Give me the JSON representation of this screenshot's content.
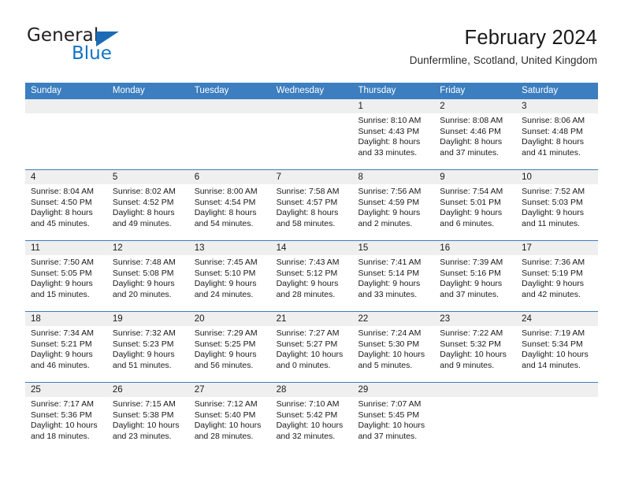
{
  "brand": {
    "name_part1": "General",
    "name_part2": "Blue",
    "logo_icon": "triangle-logo-icon",
    "accent_color": "#1b6cb5"
  },
  "header": {
    "title": "February 2024",
    "subtitle": "Dunfermline, Scotland, United Kingdom"
  },
  "colors": {
    "header_blue": "#3c7ebf",
    "day_band_gray": "#efefef",
    "text": "#1a1a1a"
  },
  "weekdays": [
    "Sunday",
    "Monday",
    "Tuesday",
    "Wednesday",
    "Thursday",
    "Friday",
    "Saturday"
  ],
  "weeks": [
    [
      {
        "day": "",
        "sunrise": "",
        "sunset": "",
        "daylight": "",
        "empty": true
      },
      {
        "day": "",
        "sunrise": "",
        "sunset": "",
        "daylight": "",
        "empty": true
      },
      {
        "day": "",
        "sunrise": "",
        "sunset": "",
        "daylight": "",
        "empty": true
      },
      {
        "day": "",
        "sunrise": "",
        "sunset": "",
        "daylight": "",
        "empty": true
      },
      {
        "day": "1",
        "sunrise": "Sunrise: 8:10 AM",
        "sunset": "Sunset: 4:43 PM",
        "daylight": "Daylight: 8 hours and 33 minutes.",
        "empty": false
      },
      {
        "day": "2",
        "sunrise": "Sunrise: 8:08 AM",
        "sunset": "Sunset: 4:46 PM",
        "daylight": "Daylight: 8 hours and 37 minutes.",
        "empty": false
      },
      {
        "day": "3",
        "sunrise": "Sunrise: 8:06 AM",
        "sunset": "Sunset: 4:48 PM",
        "daylight": "Daylight: 8 hours and 41 minutes.",
        "empty": false
      }
    ],
    [
      {
        "day": "4",
        "sunrise": "Sunrise: 8:04 AM",
        "sunset": "Sunset: 4:50 PM",
        "daylight": "Daylight: 8 hours and 45 minutes.",
        "empty": false
      },
      {
        "day": "5",
        "sunrise": "Sunrise: 8:02 AM",
        "sunset": "Sunset: 4:52 PM",
        "daylight": "Daylight: 8 hours and 49 minutes.",
        "empty": false
      },
      {
        "day": "6",
        "sunrise": "Sunrise: 8:00 AM",
        "sunset": "Sunset: 4:54 PM",
        "daylight": "Daylight: 8 hours and 54 minutes.",
        "empty": false
      },
      {
        "day": "7",
        "sunrise": "Sunrise: 7:58 AM",
        "sunset": "Sunset: 4:57 PM",
        "daylight": "Daylight: 8 hours and 58 minutes.",
        "empty": false
      },
      {
        "day": "8",
        "sunrise": "Sunrise: 7:56 AM",
        "sunset": "Sunset: 4:59 PM",
        "daylight": "Daylight: 9 hours and 2 minutes.",
        "empty": false
      },
      {
        "day": "9",
        "sunrise": "Sunrise: 7:54 AM",
        "sunset": "Sunset: 5:01 PM",
        "daylight": "Daylight: 9 hours and 6 minutes.",
        "empty": false
      },
      {
        "day": "10",
        "sunrise": "Sunrise: 7:52 AM",
        "sunset": "Sunset: 5:03 PM",
        "daylight": "Daylight: 9 hours and 11 minutes.",
        "empty": false
      }
    ],
    [
      {
        "day": "11",
        "sunrise": "Sunrise: 7:50 AM",
        "sunset": "Sunset: 5:05 PM",
        "daylight": "Daylight: 9 hours and 15 minutes.",
        "empty": false
      },
      {
        "day": "12",
        "sunrise": "Sunrise: 7:48 AM",
        "sunset": "Sunset: 5:08 PM",
        "daylight": "Daylight: 9 hours and 20 minutes.",
        "empty": false
      },
      {
        "day": "13",
        "sunrise": "Sunrise: 7:45 AM",
        "sunset": "Sunset: 5:10 PM",
        "daylight": "Daylight: 9 hours and 24 minutes.",
        "empty": false
      },
      {
        "day": "14",
        "sunrise": "Sunrise: 7:43 AM",
        "sunset": "Sunset: 5:12 PM",
        "daylight": "Daylight: 9 hours and 28 minutes.",
        "empty": false
      },
      {
        "day": "15",
        "sunrise": "Sunrise: 7:41 AM",
        "sunset": "Sunset: 5:14 PM",
        "daylight": "Daylight: 9 hours and 33 minutes.",
        "empty": false
      },
      {
        "day": "16",
        "sunrise": "Sunrise: 7:39 AM",
        "sunset": "Sunset: 5:16 PM",
        "daylight": "Daylight: 9 hours and 37 minutes.",
        "empty": false
      },
      {
        "day": "17",
        "sunrise": "Sunrise: 7:36 AM",
        "sunset": "Sunset: 5:19 PM",
        "daylight": "Daylight: 9 hours and 42 minutes.",
        "empty": false
      }
    ],
    [
      {
        "day": "18",
        "sunrise": "Sunrise: 7:34 AM",
        "sunset": "Sunset: 5:21 PM",
        "daylight": "Daylight: 9 hours and 46 minutes.",
        "empty": false
      },
      {
        "day": "19",
        "sunrise": "Sunrise: 7:32 AM",
        "sunset": "Sunset: 5:23 PM",
        "daylight": "Daylight: 9 hours and 51 minutes.",
        "empty": false
      },
      {
        "day": "20",
        "sunrise": "Sunrise: 7:29 AM",
        "sunset": "Sunset: 5:25 PM",
        "daylight": "Daylight: 9 hours and 56 minutes.",
        "empty": false
      },
      {
        "day": "21",
        "sunrise": "Sunrise: 7:27 AM",
        "sunset": "Sunset: 5:27 PM",
        "daylight": "Daylight: 10 hours and 0 minutes.",
        "empty": false
      },
      {
        "day": "22",
        "sunrise": "Sunrise: 7:24 AM",
        "sunset": "Sunset: 5:30 PM",
        "daylight": "Daylight: 10 hours and 5 minutes.",
        "empty": false
      },
      {
        "day": "23",
        "sunrise": "Sunrise: 7:22 AM",
        "sunset": "Sunset: 5:32 PM",
        "daylight": "Daylight: 10 hours and 9 minutes.",
        "empty": false
      },
      {
        "day": "24",
        "sunrise": "Sunrise: 7:19 AM",
        "sunset": "Sunset: 5:34 PM",
        "daylight": "Daylight: 10 hours and 14 minutes.",
        "empty": false
      }
    ],
    [
      {
        "day": "25",
        "sunrise": "Sunrise: 7:17 AM",
        "sunset": "Sunset: 5:36 PM",
        "daylight": "Daylight: 10 hours and 18 minutes.",
        "empty": false
      },
      {
        "day": "26",
        "sunrise": "Sunrise: 7:15 AM",
        "sunset": "Sunset: 5:38 PM",
        "daylight": "Daylight: 10 hours and 23 minutes.",
        "empty": false
      },
      {
        "day": "27",
        "sunrise": "Sunrise: 7:12 AM",
        "sunset": "Sunset: 5:40 PM",
        "daylight": "Daylight: 10 hours and 28 minutes.",
        "empty": false
      },
      {
        "day": "28",
        "sunrise": "Sunrise: 7:10 AM",
        "sunset": "Sunset: 5:42 PM",
        "daylight": "Daylight: 10 hours and 32 minutes.",
        "empty": false
      },
      {
        "day": "29",
        "sunrise": "Sunrise: 7:07 AM",
        "sunset": "Sunset: 5:45 PM",
        "daylight": "Daylight: 10 hours and 37 minutes.",
        "empty": false
      },
      {
        "day": "",
        "sunrise": "",
        "sunset": "",
        "daylight": "",
        "empty": true
      },
      {
        "day": "",
        "sunrise": "",
        "sunset": "",
        "daylight": "",
        "empty": true
      }
    ]
  ]
}
